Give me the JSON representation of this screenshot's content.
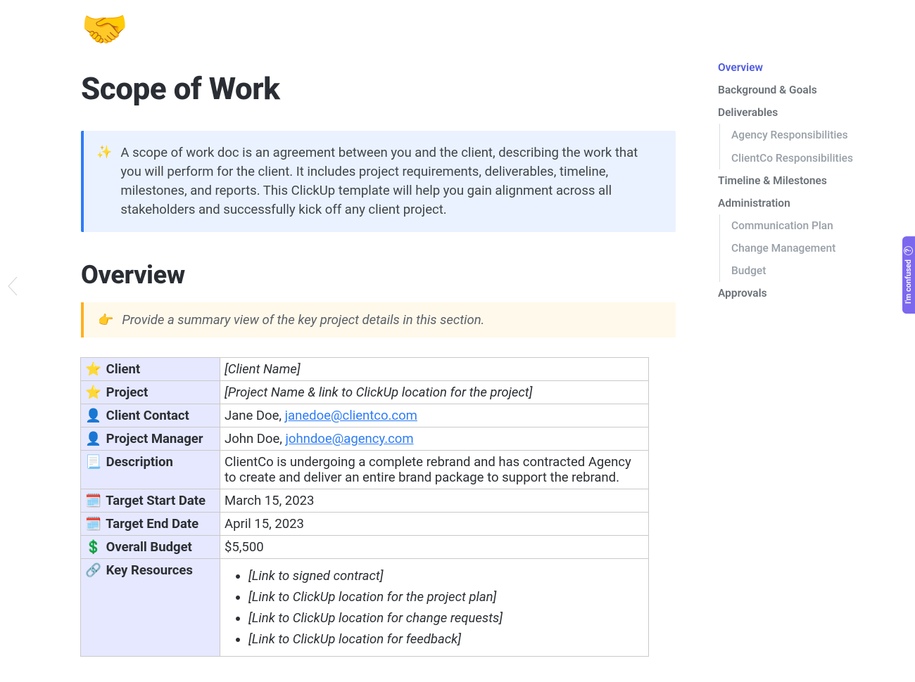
{
  "doc": {
    "icon": "🤝",
    "title": "Scope of Work"
  },
  "callout": {
    "emoji": "✨",
    "text": "A scope of work doc is an agreement between you and the client, describing the work that you will perform for the client. It includes project requirements, deliverables, timeline, milestones, and reports. This ClickUp template will help you gain alignment across all stakeholders and successfully kick off any client project."
  },
  "overview": {
    "heading": "Overview",
    "hint_emoji": "👉",
    "hint_text": "Provide a summary view of the key project details in this section.",
    "rows": {
      "client": {
        "emoji": "⭐",
        "label": "Client",
        "value": "[Client Name]"
      },
      "project": {
        "emoji": "⭐",
        "label": "Project",
        "value": "[Project Name & link to ClickUp location for the project]"
      },
      "client_contact": {
        "emoji": "👤",
        "label": "Client Contact",
        "name": "Jane Doe, ",
        "email": "janedoe@clientco.com"
      },
      "project_manager": {
        "emoji": "👤",
        "label": "Project Manager",
        "name": "John Doe, ",
        "email": "johndoe@agency.com"
      },
      "description": {
        "emoji": "📃",
        "label": "Description",
        "value": "ClientCo is undergoing a complete rebrand and has contracted Agency to create and deliver an entire brand package to support the rebrand."
      },
      "start_date": {
        "emoji": "🗓️",
        "label": "Target Start Date",
        "value": "March 15, 2023"
      },
      "end_date": {
        "emoji": "🗓️",
        "label": "Target End Date",
        "value": "April 15, 2023"
      },
      "budget": {
        "emoji": "💲",
        "label": "Overall Budget",
        "value": "$5,500"
      },
      "resources": {
        "emoji": "🔗",
        "label": "Key Resources",
        "items": [
          "[Link to signed contract]",
          "[Link to ClickUp location for the project plan]",
          "[Link to ClickUp location for change requests]",
          "[Link to ClickUp location for feedback]"
        ]
      }
    }
  },
  "toc": {
    "items": [
      {
        "label": "Overview",
        "active": true
      },
      {
        "label": "Background & Goals"
      },
      {
        "label": "Deliverables",
        "children": [
          "Agency Responsibilities",
          "ClientCo Responsibilities"
        ]
      },
      {
        "label": "Timeline & Milestones"
      },
      {
        "label": "Administration",
        "children": [
          "Communication Plan",
          "Change Management",
          "Budget"
        ]
      },
      {
        "label": "Approvals"
      }
    ]
  },
  "confused_label": "I'm confused"
}
